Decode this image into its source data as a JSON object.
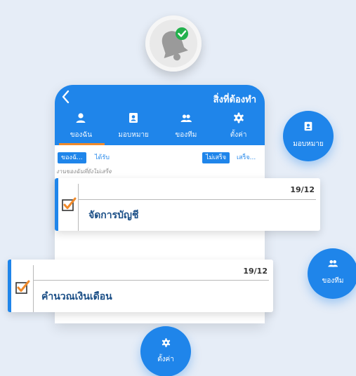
{
  "phone": {
    "title": "สิ่งที่ต้องทำ",
    "tabs": [
      {
        "label": "ของฉัน",
        "icon": "person-icon"
      },
      {
        "label": "มอบหมาย",
        "icon": "contact-badge-icon"
      },
      {
        "label": "ของทีม",
        "icon": "group-icon"
      },
      {
        "label": "ตั้งค่า",
        "icon": "gear-icon"
      }
    ],
    "filters": {
      "mine": "ของฉั...",
      "received": "ได้รับ",
      "not_done": "ไม่เสร็จ",
      "done": "เสร็จ..."
    },
    "hint": "งานของฉันที่ยังไม่เสร็จ"
  },
  "tasks": [
    {
      "date": "19/12",
      "title": "จัดการบัญชี"
    },
    {
      "date": "19/12",
      "title": "คำนวณเงินเดือน"
    }
  ],
  "fabs": {
    "assign": "มอบหมาย",
    "team": "ของทีม",
    "settings": "ตั้งค่า"
  },
  "colors": {
    "primary": "#1f85ea",
    "accent": "#f08a2b",
    "background": "#e6edf7",
    "check_green": "#22b14c"
  }
}
